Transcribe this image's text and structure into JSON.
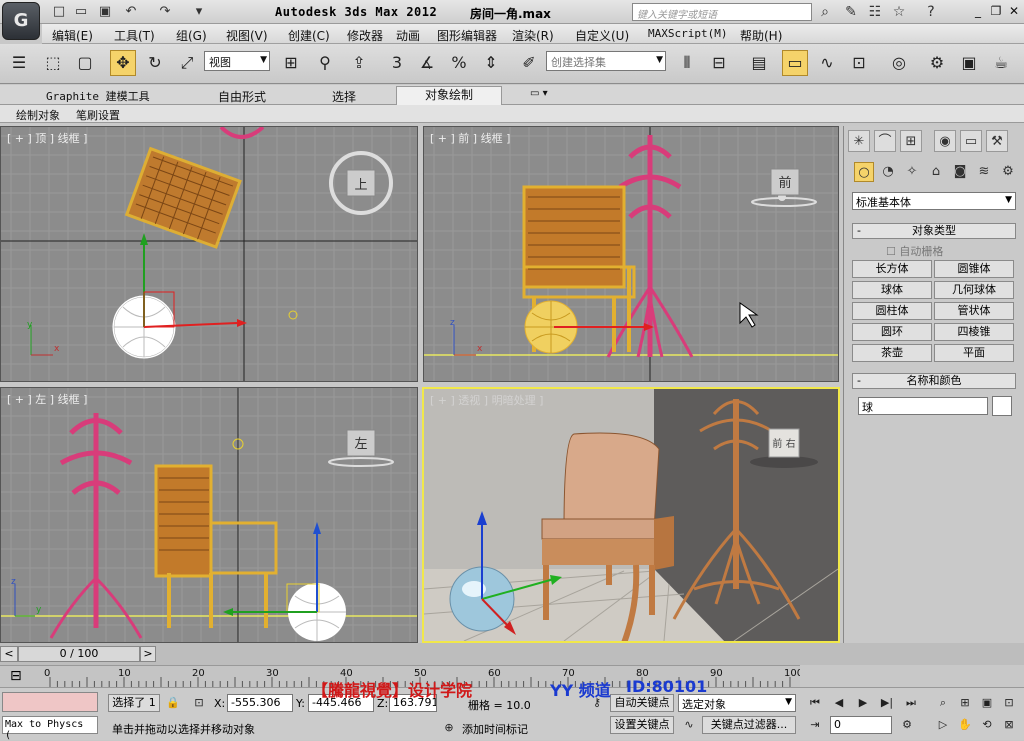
{
  "app": {
    "title": "Autodesk 3ds Max  2012",
    "file": "房间一角.max",
    "search_placeholder": "键入关键字或短语",
    "logo": "G"
  },
  "menus": [
    "编辑(E)",
    "工具(T)",
    "组(G)",
    "视图(V)",
    "创建(C)",
    "修改器",
    "动画",
    "图形编辑器",
    "渲染(R)",
    "自定义(U)",
    "MAXScript(M)",
    "帮助(H)"
  ],
  "toolbar": {
    "ref_coord": "视图",
    "selection_set": "创建选择集",
    "snap_angle": "3"
  },
  "ribbon": {
    "tabs": [
      "Graphite 建模工具",
      "自由形式",
      "选择",
      "对象绘制"
    ],
    "sub": [
      "绘制对象",
      "笔刷设置"
    ]
  },
  "viewports": {
    "top": "[ + ] 顶 ] 线框 ]",
    "front": "[ + ] 前 ] 线框 ]",
    "left": "[ + ] 左 ] 线框 ]",
    "persp": "[ + ] 透视 ] 明暗处理 ]"
  },
  "viewcube": {
    "top": "上",
    "front": "前",
    "left": "左",
    "persp": "前 右"
  },
  "axis": {
    "x": "x",
    "y": "y",
    "z": "z"
  },
  "panel": {
    "category": "标准基本体",
    "object_type": "对象类型",
    "auto_grid": "自动栅格",
    "buttons": [
      "长方体",
      "圆锥体",
      "球体",
      "几何球体",
      "圆柱体",
      "管状体",
      "圆环",
      "四棱锥",
      "茶壶",
      "平面"
    ],
    "name_color": "名称和颜色",
    "name": "球"
  },
  "timeline": {
    "frame": "0 / 100",
    "ticks": [
      "0",
      "10",
      "20",
      "30",
      "40",
      "50",
      "60",
      "70",
      "80",
      "90",
      "100"
    ]
  },
  "status": {
    "maxscript": "Max to Physcs (",
    "selected": "选择了 1",
    "x_label": "X:",
    "x": "-555.306",
    "y_label": "Y:",
    "y": "-445.466",
    "z_label": "Z:",
    "z": "163.791",
    "grid": "栅格 = 10.0",
    "prompt": "单击并拖动以选择并移动对象",
    "add_time_tag": "添加时间标记",
    "auto_key": "自动关键点",
    "set_key": "设置关键点",
    "selected_object": "选定对象",
    "key_filters": "关键点过滤器...",
    "frame": "0"
  },
  "watermark": {
    "brand": "【騰龍視覺】设计学院",
    "channel": "YY 频道",
    "id": "ID:80101"
  }
}
